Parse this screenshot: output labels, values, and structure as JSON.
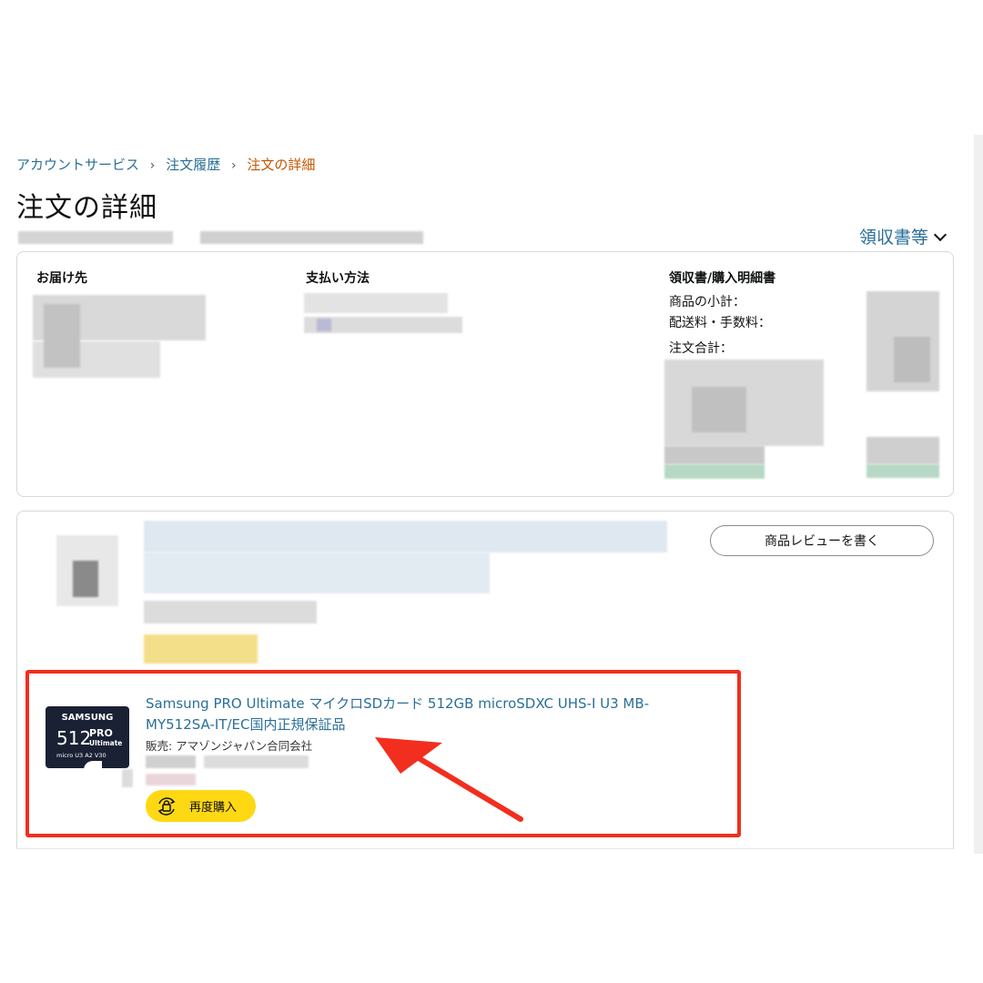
{
  "breadcrumb": {
    "items": [
      "アカウントサービス",
      "注文履歴"
    ],
    "current": "注文の詳細",
    "separator": "›"
  },
  "page": {
    "title": "注文の詳細"
  },
  "receipts_menu": {
    "label": "領収書等",
    "icon": "chevron-down-icon"
  },
  "summary": {
    "shipping_heading": "お届け先",
    "payment_heading": "支払い方法",
    "receipt_heading": "領収書/購入明細書",
    "rows": {
      "subtotal": "商品の小計：",
      "shipping": "配送料・手数料：",
      "total": "注文合計："
    }
  },
  "item": {
    "review_button": "商品レビューを書く",
    "product_title": "Samsung PRO Ultimate マイクロSDカード 512GB microSDXC UHS-I U3 MB-MY512SA-IT/EC国内正規保証品",
    "seller": "販売: アマゾンジャパン合同会社",
    "buy_again": "再度購入",
    "image": {
      "brand": "SAMSUNG",
      "capacity": "512",
      "line1": "PRO",
      "line2": "Ultimate",
      "class_row": "micro U3 A2 V30"
    }
  },
  "colors": {
    "link": "#2a6f97",
    "current_crumb": "#c45500",
    "buy_again": "#ffd814",
    "highlight": "#f22e1e"
  }
}
